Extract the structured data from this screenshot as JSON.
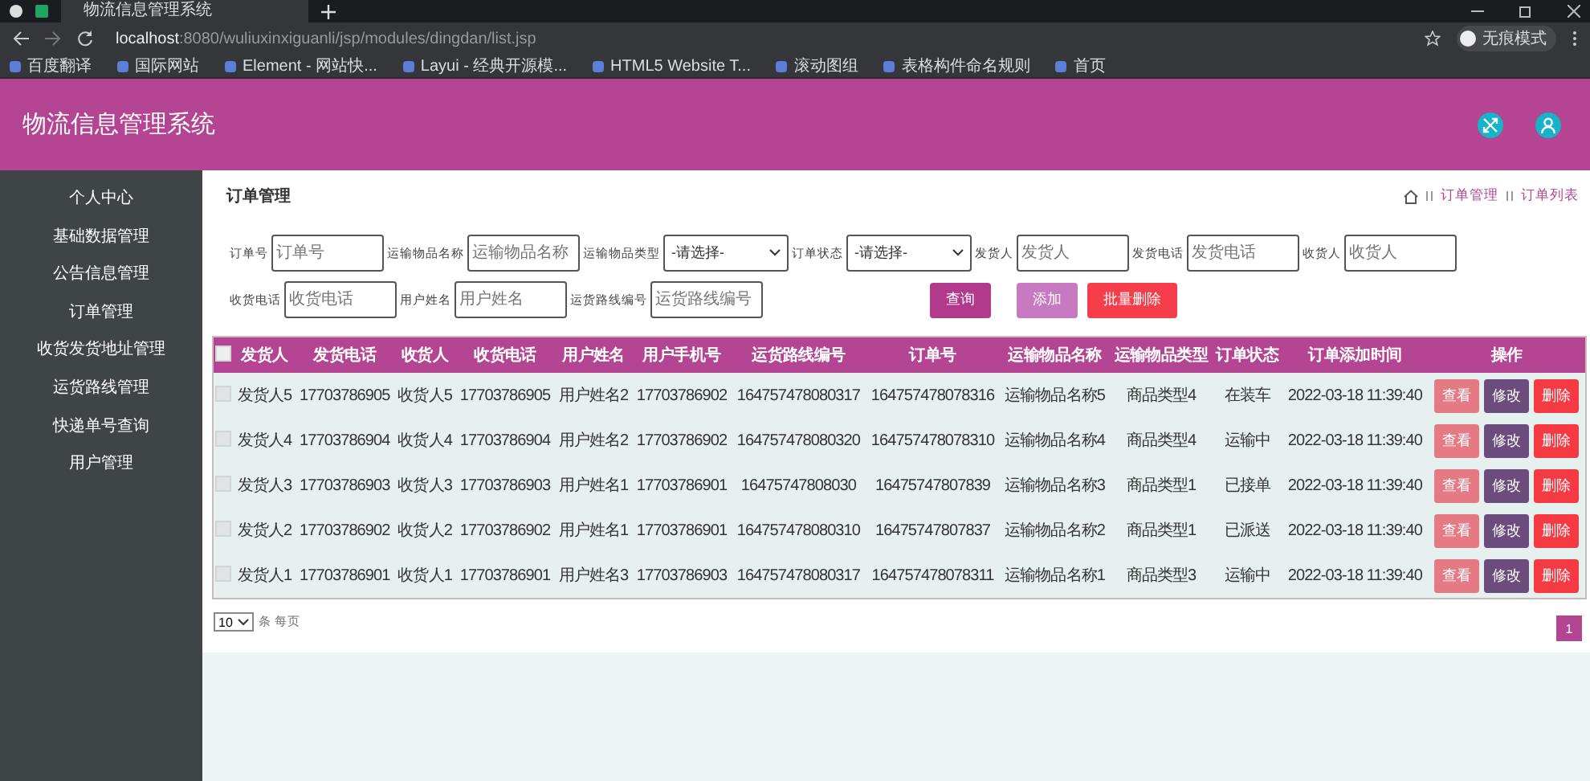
{
  "browser": {
    "tabs": [
      {
        "title": "物流信息管理系统",
        "selected": true
      }
    ],
    "url_host": "localhost",
    "url_rest": ":8080/wuliuxinxiguanli/jsp/modules/dingdan/list.jsp",
    "profile": "无痕模式",
    "bookmarks": [
      "百度翻译",
      "国际网站",
      "Element - 网站快...",
      "Layui - 经典开源模...",
      "HTML5 Website T...",
      "滚动图组",
      "表格构件命名规则",
      "首页"
    ]
  },
  "app": {
    "title": "物流信息管理系统"
  },
  "sidebar": {
    "items": [
      {
        "label": "个人中心"
      },
      {
        "label": "基础数据管理"
      },
      {
        "label": "公告信息管理"
      },
      {
        "label": "订单管理"
      },
      {
        "label": "收货发货地址管理"
      },
      {
        "label": "运货路线管理"
      },
      {
        "label": "快递单号查询"
      },
      {
        "label": "用户管理"
      }
    ]
  },
  "page": {
    "title": "订单管理",
    "breadcrumb": [
      "订单管理",
      "订单列表"
    ]
  },
  "filters": [
    {
      "label": "订单号",
      "kind": "input",
      "placeholder": "订单号"
    },
    {
      "label": "运输物品名称",
      "kind": "input",
      "placeholder": "运输物品名称"
    },
    {
      "label": "运输物品类型",
      "kind": "select",
      "value": "-请选择-"
    },
    {
      "label": "订单状态",
      "kind": "select",
      "value": "-请选择-"
    },
    {
      "label": "发货人",
      "kind": "input",
      "placeholder": "发货人"
    },
    {
      "label": "发货电话",
      "kind": "input",
      "placeholder": "发货电话"
    },
    {
      "label": "收货人",
      "kind": "input",
      "placeholder": "收货人"
    },
    {
      "label": "收货电话",
      "kind": "input",
      "placeholder": "收货电话"
    },
    {
      "label": "用户姓名",
      "kind": "input",
      "placeholder": "用户姓名"
    },
    {
      "label": "运货路线编号",
      "kind": "input",
      "placeholder": "运货路线编号"
    }
  ],
  "buttons": [
    {
      "label": "查询",
      "kind": "search"
    },
    {
      "label": "添加",
      "kind": "add"
    },
    {
      "label": "批量删除",
      "kind": "delete"
    }
  ],
  "table": {
    "select_all_checked": false,
    "columns": [
      "发货人",
      "发货电话",
      "收货人",
      "收货电话",
      "用户姓名",
      "用户手机号",
      "运货路线编号",
      "订单号",
      "运输物品名称",
      "运输物品类型",
      "订单状态",
      "订单添加时间",
      "操作"
    ],
    "rows": [
      {
        "checked": false,
        "cells": [
          "发货人5",
          "17703786905",
          "收货人5",
          "17703786905",
          "用户姓名2",
          "17703786902",
          "164757478080317",
          "164757478078316",
          "运输物品名称5",
          "商品类型4",
          "在装车",
          "2022-03-18 11:39:40"
        ],
        "actions": [
          "查看",
          "修改",
          "删除"
        ]
      },
      {
        "checked": false,
        "cells": [
          "发货人4",
          "17703786904",
          "收货人4",
          "17703786904",
          "用户姓名2",
          "17703786902",
          "164757478080320",
          "164757478078310",
          "运输物品名称4",
          "商品类型4",
          "运输中",
          "2022-03-18 11:39:40"
        ],
        "actions": [
          "查看",
          "修改",
          "删除"
        ]
      },
      {
        "checked": false,
        "cells": [
          "发货人3",
          "17703786903",
          "收货人3",
          "17703786903",
          "用户姓名1",
          "17703786901",
          "16475747808030",
          "16475747807839",
          "运输物品名称3",
          "商品类型1",
          "已接单",
          "2022-03-18 11:39:40"
        ],
        "actions": [
          "查看",
          "修改",
          "删除"
        ]
      },
      {
        "checked": false,
        "cells": [
          "发货人2",
          "17703786902",
          "收货人2",
          "17703786902",
          "用户姓名1",
          "17703786901",
          "164757478080310",
          "16475747807837",
          "运输物品名称2",
          "商品类型1",
          "已派送",
          "2022-03-18 11:39:40"
        ],
        "actions": [
          "查看",
          "修改",
          "删除"
        ]
      },
      {
        "checked": false,
        "cells": [
          "发货人1",
          "17703786901",
          "收货人1",
          "17703786901",
          "用户姓名3",
          "17703786903",
          "164757478080317",
          "164757478078311",
          "运输物品名称1",
          "商品类型3",
          "运输中",
          "2022-03-18 11:39:40"
        ],
        "actions": [
          "查看",
          "修改",
          "删除"
        ]
      }
    ]
  },
  "page_size": {
    "value": "10",
    "suffix": "条 每页"
  },
  "pagination": [
    {
      "label": "1",
      "selected": true
    }
  ]
}
